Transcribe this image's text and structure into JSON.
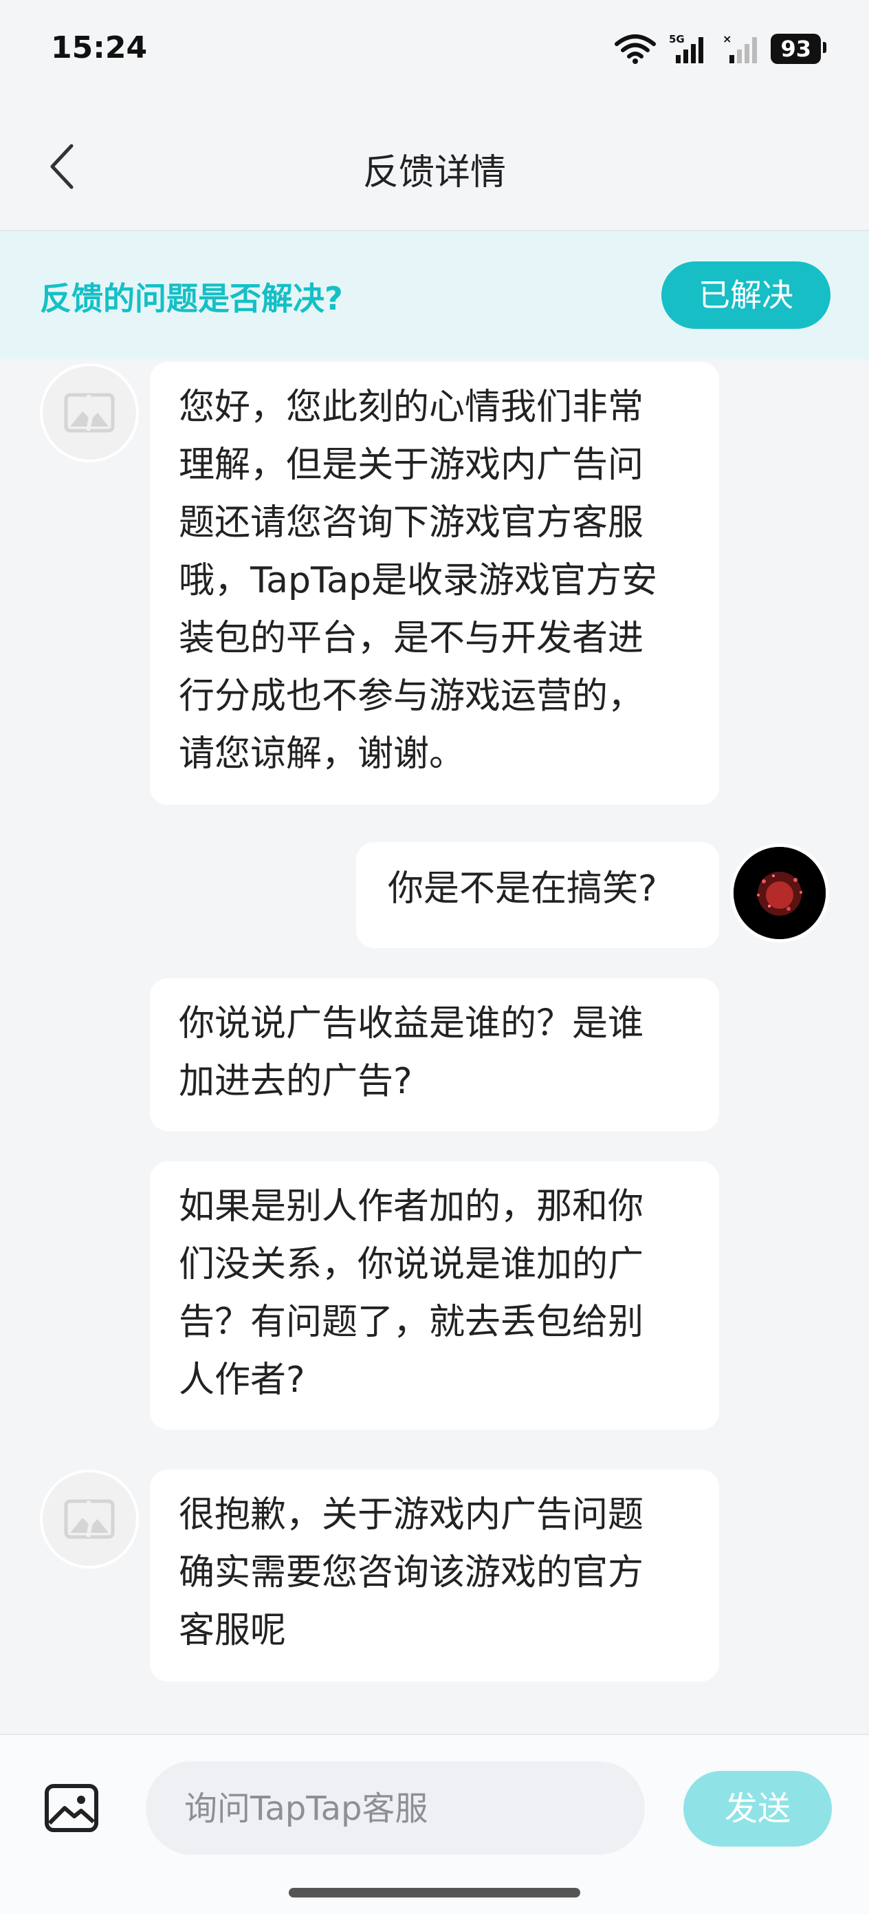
{
  "status_bar": {
    "time": "15:24",
    "battery": "93",
    "network": "5G"
  },
  "nav": {
    "title": "反馈详情",
    "back_icon": "chevron-left-icon"
  },
  "banner": {
    "question": "反馈的问题是否解决?",
    "resolved_label": "已解决"
  },
  "messages": [
    {
      "from": "support",
      "lines": [
        "您好，您此刻的心情我们非常",
        "理解，但是关于游戏内广告问",
        "题还请您咨询下游戏官方客服",
        "哦，TapTap是收录游戏官方安",
        "装包的平台，是不与开发者进",
        "行分成也不参与游戏运营的，",
        "请您谅解，谢谢。"
      ]
    },
    {
      "from": "user",
      "lines": [
        "你是不是在搞笑?"
      ]
    },
    {
      "from": "user",
      "lines": [
        "你说说广告收益是谁的？是谁",
        "加进去的广告?"
      ]
    },
    {
      "from": "user",
      "lines": [
        "如果是别人作者加的，那和你",
        "们没关系，你说说是谁加的广",
        "告？有问题了，就去丢包给别",
        "人作者?"
      ]
    },
    {
      "from": "support",
      "lines": [
        "很抱歉，关于游戏内广告问题",
        "确实需要您咨询该游戏的官方",
        "客服呢"
      ]
    }
  ],
  "composer": {
    "placeholder": "询问TapTap客服",
    "send_label": "发送",
    "image_icon": "image-icon"
  },
  "colors": {
    "accent": "#17bec6",
    "send_disabled": "#8fe3e6",
    "banner_bg": "#e6f6f8"
  }
}
